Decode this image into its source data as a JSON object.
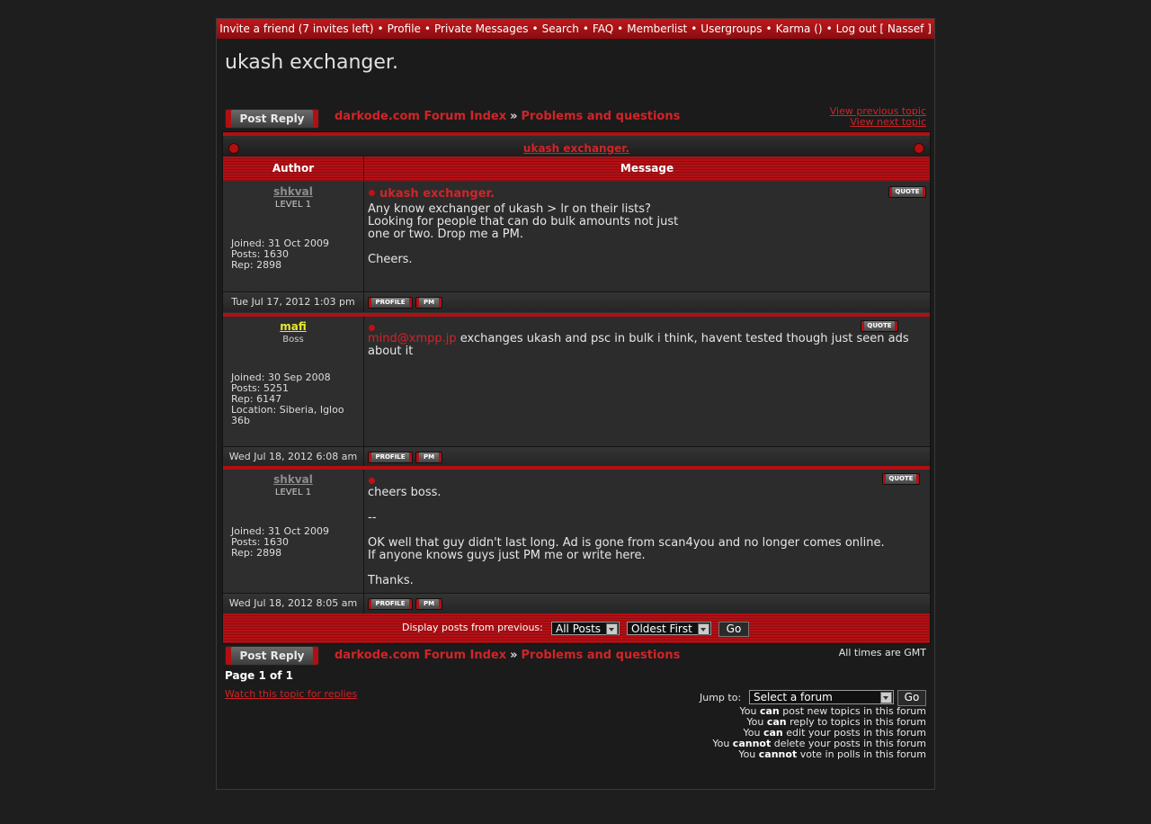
{
  "nav": {
    "items": [
      "Invite a friend (7 invites left)",
      "Profile",
      "Private Messages",
      "Search",
      "FAQ",
      "Memberlist",
      "Usergroups",
      "Karma ()",
      "Log out [ Nassef ]"
    ]
  },
  "topic": {
    "title": "ukash exchanger.",
    "post_reply_label": "Post Reply",
    "breadcrumb_index": "darkode.com Forum Index",
    "breadcrumb_sep": "»",
    "breadcrumb_forum": "Problems and questions",
    "view_previous": "View previous topic",
    "view_next": "View next topic"
  },
  "table": {
    "header_title": "ukash exchanger.",
    "col_author": "Author",
    "col_message": "Message",
    "quote_label": "QUOTE",
    "profile_label": "PROFILE",
    "pm_label": "PM"
  },
  "posts": [
    {
      "username": "shkval",
      "rank": "LEVEL 1",
      "info": [
        "Joined: 31 Oct 2009",
        "Posts: 1630",
        "Rep: 2898"
      ],
      "subject": "ukash exchanger.",
      "body": [
        "Any know exchanger of ukash > lr on their lists?",
        "Looking for people that can do bulk amounts not just",
        "one or two. Drop me a PM.",
        "",
        "Cheers."
      ],
      "date": "Tue Jul 17, 2012 1:03 pm"
    },
    {
      "username": "mafi",
      "rank": "Boss",
      "info": [
        "Joined: 30 Sep 2008",
        "Posts: 5251",
        "Rep: 6147",
        "Location: Siberia, Igloo",
        "36b"
      ],
      "subject": "",
      "link": "mind@xmpp.jp",
      "body_line1": " exchanges ukash and psc in bulk i think, havent tested though just seen ads",
      "body_line2": "about it",
      "date": "Wed Jul 18, 2012 6:08 am"
    },
    {
      "username": "shkval",
      "rank": "LEVEL 1",
      "info": [
        "Joined: 31 Oct 2009",
        "Posts: 1630",
        "Rep: 2898"
      ],
      "subject": "",
      "body": [
        "cheers boss.",
        "",
        "--",
        "",
        "OK well that guy didn't last long. Ad is gone from scan4you and no longer comes online.",
        "If anyone knows guys just PM me or write here.",
        "",
        "Thanks."
      ],
      "date": "Wed Jul 18, 2012 8:05 am"
    }
  ],
  "display": {
    "label": "Display posts from previous:",
    "range_value": "All Posts",
    "order_value": "Oldest First",
    "go_label": "Go"
  },
  "footer": {
    "timezone": "All times are GMT",
    "page_info": "Page 1 of 1",
    "watch_link": "Watch this topic for replies",
    "jump_label": "Jump to:",
    "jump_value": "Select a forum",
    "jump_go": "Go",
    "permissions": [
      [
        "You ",
        "can",
        " post new topics in this forum"
      ],
      [
        "You ",
        "can",
        " reply to topics in this forum"
      ],
      [
        "You ",
        "can",
        " edit your posts in this forum"
      ],
      [
        "You ",
        "cannot",
        " delete your posts in this forum"
      ],
      [
        "You ",
        "cannot",
        " vote in polls in this forum"
      ]
    ]
  },
  "colors": {
    "accent_red": "#d12428",
    "username_gray": "#8c8c8c",
    "username_yellow": "#e8e830"
  }
}
